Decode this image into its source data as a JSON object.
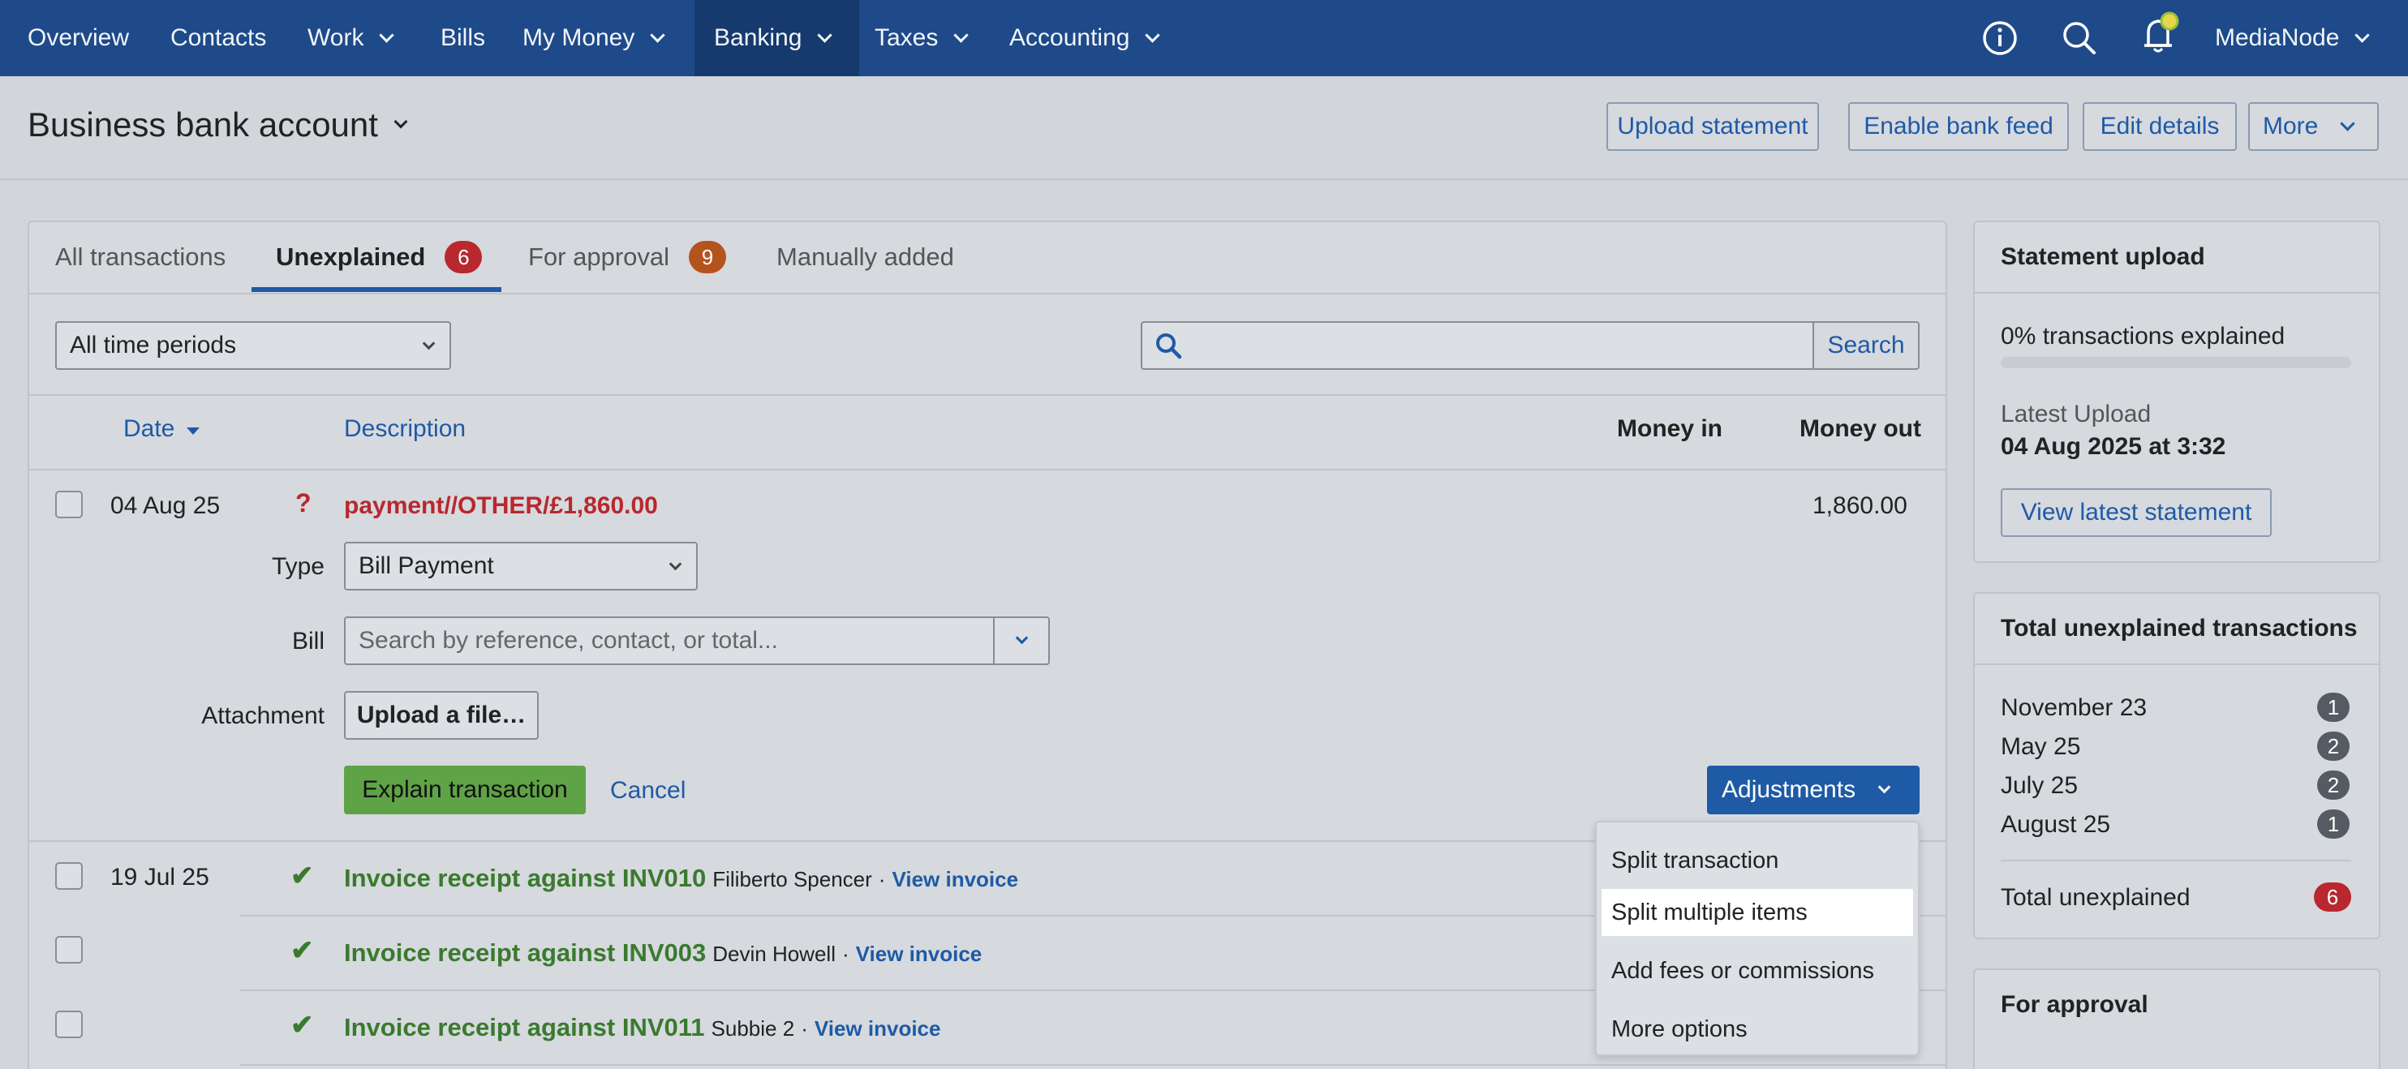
{
  "nav": {
    "items": [
      {
        "label": "Overview"
      },
      {
        "label": "Contacts"
      },
      {
        "label": "Work"
      },
      {
        "label": "Bills"
      },
      {
        "label": "My Money"
      },
      {
        "label": "Banking"
      },
      {
        "label": "Taxes"
      },
      {
        "label": "Accounting"
      }
    ],
    "account_name": "MediaNode"
  },
  "header": {
    "title": "Business bank account",
    "buttons": {
      "upload_statement": "Upload statement",
      "enable_bank_feed": "Enable bank feed",
      "edit_details": "Edit details",
      "more": "More"
    }
  },
  "tabs": {
    "all": "All transactions",
    "unexplained": "Unexplained",
    "unexplained_count": "6",
    "for_approval": "For approval",
    "for_approval_count": "9",
    "manually_added": "Manually added"
  },
  "filters": {
    "period": "All time periods",
    "search_button": "Search"
  },
  "columns": {
    "date": "Date",
    "description": "Description",
    "money_in": "Money in",
    "money_out": "Money out"
  },
  "expanded_row": {
    "date": "04 Aug 25",
    "status_icon": "?",
    "description": "payment//OTHER/£1,860.00",
    "money_out": "1,860.00",
    "type_label": "Type",
    "type_value": "Bill Payment",
    "bill_label": "Bill",
    "bill_placeholder": "Search by reference, contact, or total...",
    "attachment_label": "Attachment",
    "upload_button": "Upload a file…",
    "explain_button": "Explain transaction",
    "cancel_link": "Cancel",
    "adjustments_button": "Adjustments"
  },
  "adjustments_menu": [
    "Split transaction",
    "Split multiple items",
    "Add fees or commissions",
    "More options"
  ],
  "rows": [
    {
      "date": "19 Jul 25",
      "title": "Invoice receipt against INV010",
      "contact": "Filiberto Spencer",
      "sep": "·",
      "link": "View invoice"
    },
    {
      "date": "",
      "title": "Invoice receipt against INV003",
      "contact": "Devin Howell",
      "sep": "·",
      "link": "View invoice"
    },
    {
      "date": "",
      "title": "Invoice receipt against INV011",
      "contact": "Subbie 2",
      "sep": "·",
      "link": "View invoice"
    }
  ],
  "statement_upload": {
    "title": "Statement upload",
    "explained_text": "0% transactions explained",
    "explained_fraction": 0,
    "latest_label": "Latest Upload",
    "latest_value": "04 Aug 2025 at 3:32",
    "view_button": "View latest statement"
  },
  "unexplained_panel": {
    "title": "Total unexplained transactions",
    "months": [
      {
        "label": "November 23",
        "count": "1"
      },
      {
        "label": "May 25",
        "count": "2"
      },
      {
        "label": "July 25",
        "count": "2"
      },
      {
        "label": "August 25",
        "count": "1"
      }
    ],
    "total_label": "Total unexplained",
    "total_count": "6"
  },
  "approval_panel": {
    "title": "For approval"
  },
  "colors": {
    "nav_bg": "#1e4a8a",
    "accent": "#1e5aa6",
    "badge_red": "#b8282e",
    "badge_orange": "#b5531c",
    "success_green": "#5fa347",
    "unexplained_red": "#b8282e"
  }
}
